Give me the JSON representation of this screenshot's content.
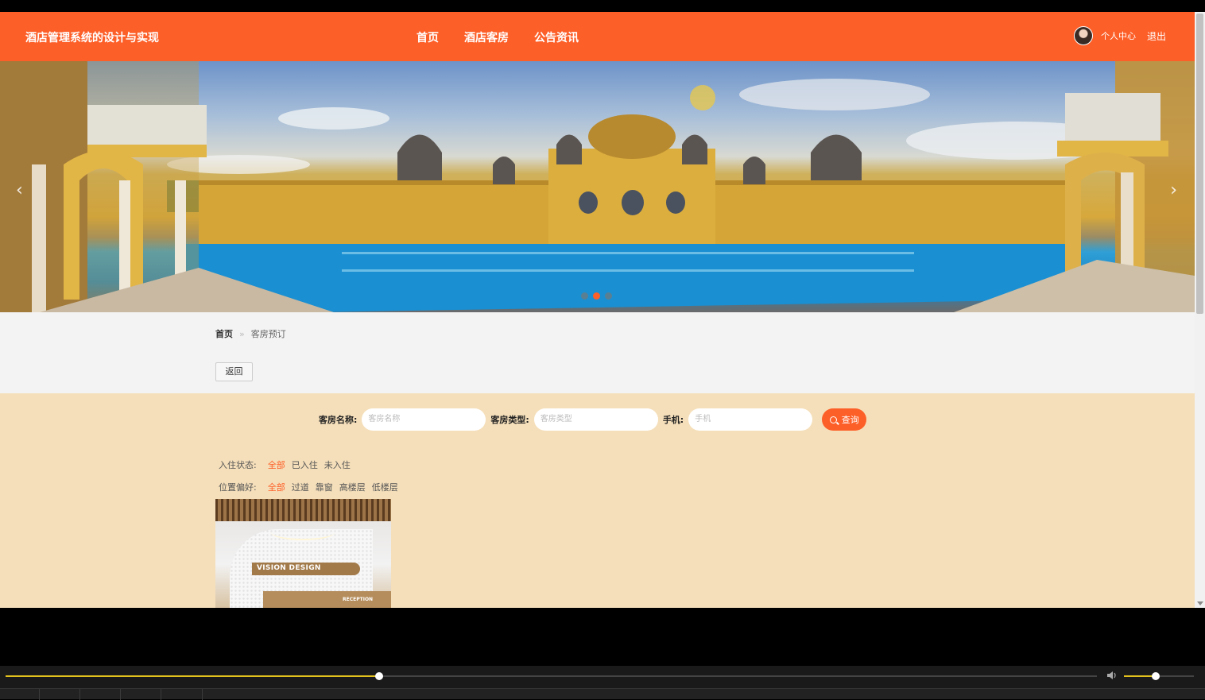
{
  "header": {
    "site_title": "酒店管理系统的设计与实现",
    "nav": [
      {
        "label": "首页"
      },
      {
        "label": "酒店客房"
      },
      {
        "label": "公告资讯"
      }
    ],
    "profile": "个人中心",
    "logout": "退出"
  },
  "banner": {
    "prev": "‹",
    "next": "›",
    "active_slide": 2,
    "slide_count": 3
  },
  "breadcrumb": {
    "home": "首页",
    "separator": "»",
    "current": "客房预订"
  },
  "back_button": "返回",
  "search": {
    "room_name_label": "客房名称:",
    "room_name_placeholder": "客房名称",
    "room_type_label": "客房类型:",
    "room_type_placeholder": "客房类型",
    "phone_label": "手机:",
    "phone_placeholder": "手机",
    "button": "查询"
  },
  "filters": {
    "checkin": {
      "label": "入住状态:",
      "options": [
        "全部",
        "已入住",
        "未入住"
      ],
      "active": 0
    },
    "position": {
      "label": "位置偏好:",
      "options": [
        "全部",
        "过道",
        "靠窗",
        "高楼层",
        "低楼层"
      ],
      "active": 0
    }
  },
  "room_card": {
    "brand_text": "VISION DESIGN",
    "sign_text": "RECEPTION"
  },
  "player": {
    "progress": 0.342,
    "volume": 0.45
  },
  "colors": {
    "accent": "#fd5f28",
    "panel": "#f5dfba"
  }
}
